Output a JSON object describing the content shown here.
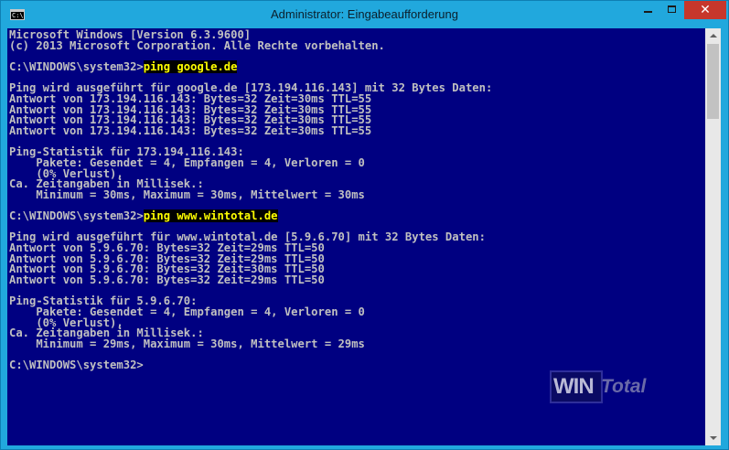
{
  "window": {
    "title": "Administrator: Eingabeaufforderung",
    "icon_label": "C:\\",
    "close_glyph": "✕"
  },
  "console": {
    "lines": [
      {
        "text": "Microsoft Windows [Version 6.3.9600]"
      },
      {
        "text": "(c) 2013 Microsoft Corporation. Alle Rechte vorbehalten."
      },
      {
        "text": ""
      },
      {
        "prompt": "C:\\WINDOWS\\system32>",
        "command": "ping google.de"
      },
      {
        "text": ""
      },
      {
        "text": "Ping wird ausgeführt für google.de [173.194.116.143] mit 32 Bytes Daten:"
      },
      {
        "text": "Antwort von 173.194.116.143: Bytes=32 Zeit=30ms TTL=55"
      },
      {
        "text": "Antwort von 173.194.116.143: Bytes=32 Zeit=30ms TTL=55"
      },
      {
        "text": "Antwort von 173.194.116.143: Bytes=32 Zeit=30ms TTL=55"
      },
      {
        "text": "Antwort von 173.194.116.143: Bytes=32 Zeit=30ms TTL=55"
      },
      {
        "text": ""
      },
      {
        "text": "Ping-Statistik für 173.194.116.143:"
      },
      {
        "text": "    Pakete: Gesendet = 4, Empfangen = 4, Verloren = 0"
      },
      {
        "text": "    (0% Verlust),"
      },
      {
        "text": "Ca. Zeitangaben in Millisek.:"
      },
      {
        "text": "    Minimum = 30ms, Maximum = 30ms, Mittelwert = 30ms"
      },
      {
        "text": ""
      },
      {
        "prompt": "C:\\WINDOWS\\system32>",
        "command": "ping www.wintotal.de"
      },
      {
        "text": ""
      },
      {
        "text": "Ping wird ausgeführt für www.wintotal.de [5.9.6.70] mit 32 Bytes Daten:"
      },
      {
        "text": "Antwort von 5.9.6.70: Bytes=32 Zeit=29ms TTL=50"
      },
      {
        "text": "Antwort von 5.9.6.70: Bytes=32 Zeit=29ms TTL=50"
      },
      {
        "text": "Antwort von 5.9.6.70: Bytes=32 Zeit=30ms TTL=50"
      },
      {
        "text": "Antwort von 5.9.6.70: Bytes=32 Zeit=29ms TTL=50"
      },
      {
        "text": ""
      },
      {
        "text": "Ping-Statistik für 5.9.6.70:"
      },
      {
        "text": "    Pakete: Gesendet = 4, Empfangen = 4, Verloren = 0"
      },
      {
        "text": "    (0% Verlust),"
      },
      {
        "text": "Ca. Zeitangaben in Millisek.:"
      },
      {
        "text": "    Minimum = 29ms, Maximum = 30ms, Mittelwert = 29ms"
      },
      {
        "text": ""
      },
      {
        "prompt": "C:\\WINDOWS\\system32>",
        "command": ""
      }
    ]
  },
  "watermark": {
    "part1": "WIN",
    "part2": "Total"
  },
  "colors": {
    "console_bg": "#000081",
    "console_text": "#c0c0c0",
    "command_highlight": "#ffff00",
    "titlebar": "#21a8dd",
    "close_button": "#c7372b"
  }
}
